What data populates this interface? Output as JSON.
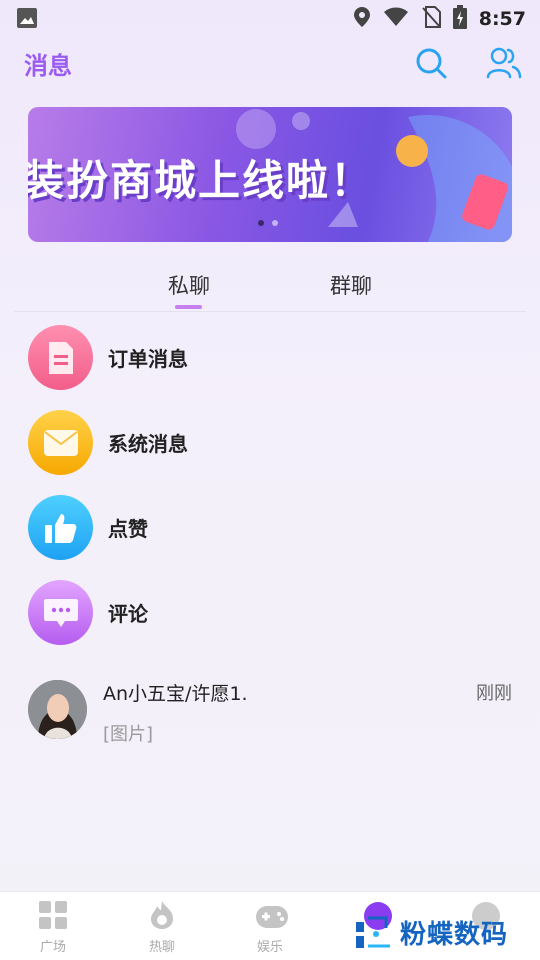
{
  "status_bar": {
    "time": "8:57"
  },
  "header": {
    "title": "消息"
  },
  "banner": {
    "text": "装扮商城上线啦！",
    "active_slide": 1,
    "slides": 2
  },
  "tabs": [
    {
      "label": "私聊"
    },
    {
      "label": "群聊"
    }
  ],
  "menu": [
    {
      "label": "订单消息",
      "icon": "order-icon"
    },
    {
      "label": "系统消息",
      "icon": "mail-icon"
    },
    {
      "label": "点赞",
      "icon": "thumbs-up-icon"
    },
    {
      "label": "评论",
      "icon": "comment-icon"
    }
  ],
  "chat": {
    "name": "An小五宝/许愿1.",
    "preview": "[图片]",
    "time": "刚刚"
  },
  "bottom_nav": [
    {
      "label": "广场",
      "icon": "grid-icon"
    },
    {
      "label": "热聊",
      "icon": "flame-icon"
    },
    {
      "label": "娱乐",
      "icon": "gamepad-icon"
    }
  ],
  "watermark": {
    "text": "粉蝶数码"
  },
  "colors": {
    "accent": "#9b5cf0",
    "tab_indicator": "#c77ff0",
    "watermark": "#1565c0"
  }
}
